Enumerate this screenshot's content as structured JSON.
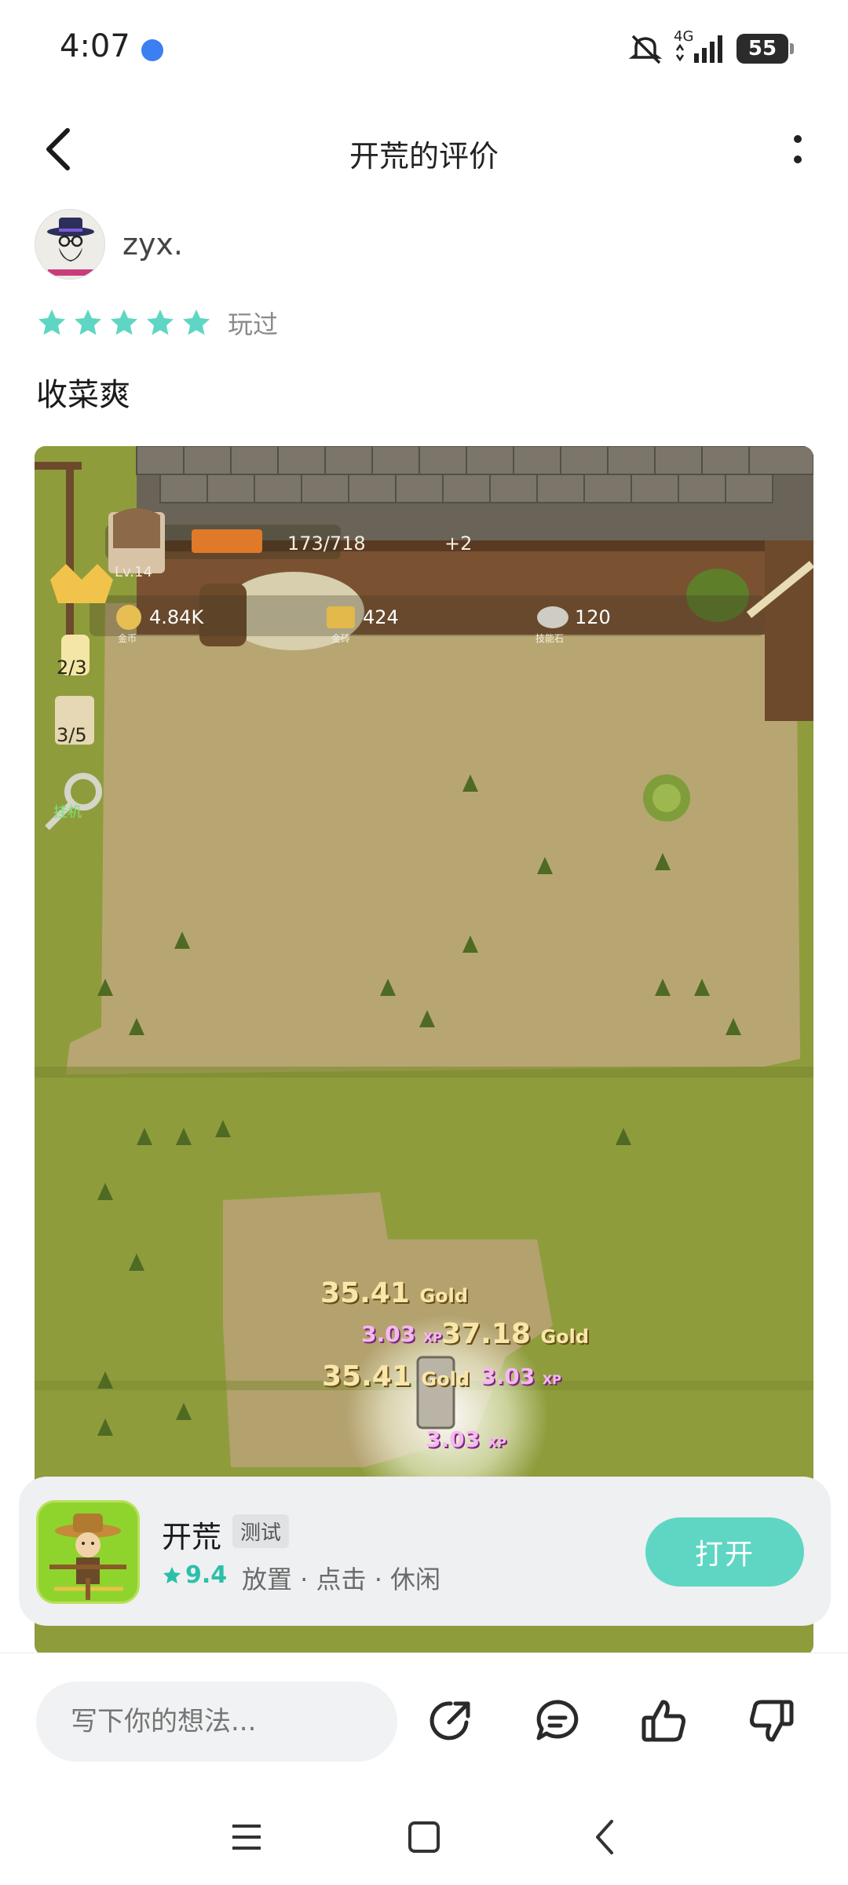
{
  "status_bar": {
    "time": "4:07",
    "network": "4G",
    "battery": "55"
  },
  "header": {
    "title": "开荒的评价"
  },
  "review": {
    "author": "zyx.",
    "rating": 5,
    "rating_max": 5,
    "played_label": "玩过",
    "text": "收菜爽"
  },
  "game_screenshot": {
    "level": "Lv.14",
    "xp_progress": "173/718",
    "tool_bonus": "+2",
    "coins": "4.84K",
    "coins_label": "金币",
    "gold_bars": "424",
    "gold_bars_label": "金砖",
    "skill_stones": "120",
    "skill_stones_label": "技能石",
    "candle_count": "2/3",
    "drink_count": "3/5",
    "idle_label": "挂机",
    "floating_texts": [
      {
        "value": "35.41",
        "unit": "Gold"
      },
      {
        "value": "3.03",
        "unit": "XP"
      },
      {
        "value": "37.18",
        "unit": "Gold"
      },
      {
        "value": "35.41",
        "unit": "Gold"
      },
      {
        "value": "3.03",
        "unit": "XP"
      },
      {
        "value": "3.03",
        "unit": "XP"
      }
    ]
  },
  "app_card": {
    "name": "开荒",
    "tag": "测试",
    "score": "9.4",
    "genres": "放置 · 点击 · 休闲",
    "open_label": "打开"
  },
  "bottom_bar": {
    "input_placeholder": "写下你的想法..."
  },
  "colors": {
    "accent": "#5fd6c3",
    "star": "#5fd6c3",
    "score": "#2cbfa8"
  }
}
